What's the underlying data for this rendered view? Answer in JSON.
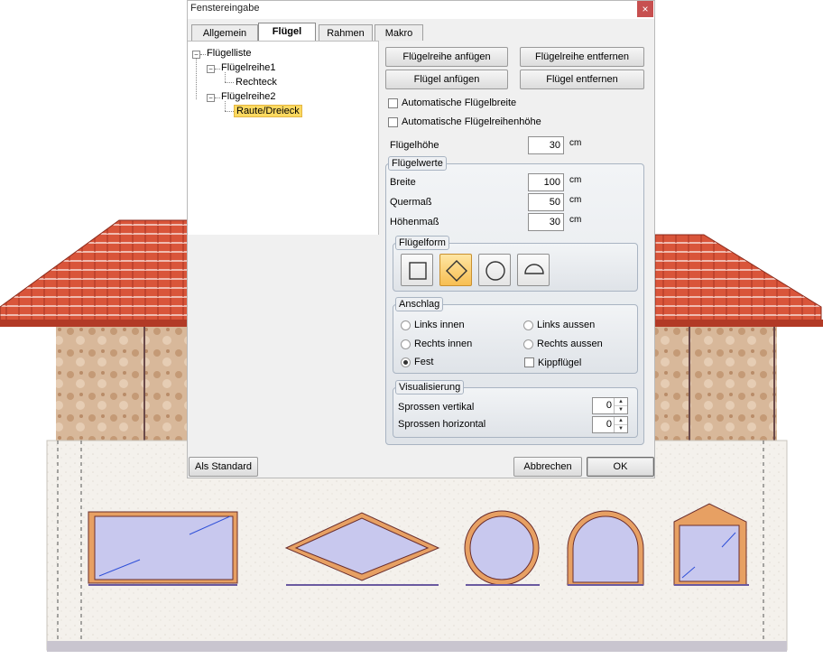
{
  "window": {
    "title": "Fenstereingabe",
    "close_glyph": "×"
  },
  "tabs": [
    {
      "label": "Allgemein"
    },
    {
      "label": "Flügel"
    },
    {
      "label": "Rahmen"
    },
    {
      "label": "Makro"
    }
  ],
  "active_tab": "Flügel",
  "tree": {
    "root": "Flügelliste",
    "rows": [
      {
        "label": "Flügelreihe1",
        "child": "Rechteck"
      },
      {
        "label": "Flügelreihe2",
        "child": "Raute/Dreieck"
      }
    ],
    "selected": "Raute/Dreieck"
  },
  "buttons": {
    "add_row": "Flügelreihe anfügen",
    "remove_row": "Flügelreihe entfernen",
    "add_sash": "Flügel anfügen",
    "remove_sash": "Flügel entfernen",
    "default": "Als Standard",
    "cancel": "Abbrechen",
    "ok": "OK"
  },
  "options": {
    "auto_width": "Automatische Flügelbreite",
    "auto_row_height": "Automatische Flügelreihenhöhe"
  },
  "sash_height": {
    "label": "Flügelhöhe",
    "value": "30",
    "unit": "cm"
  },
  "sash_values": {
    "title": "Flügelwerte",
    "fields": [
      {
        "label": "Breite",
        "value": "100",
        "unit": "cm"
      },
      {
        "label": "Quermaß",
        "value": "50",
        "unit": "cm"
      },
      {
        "label": "Höhenmaß",
        "value": "30",
        "unit": "cm"
      }
    ]
  },
  "sash_shape": {
    "title": "Flügelform",
    "shapes": [
      "square-icon",
      "diamond-icon",
      "circle-icon",
      "semicircle-icon"
    ],
    "selected": "diamond-icon"
  },
  "hinge": {
    "title": "Anschlag",
    "options": [
      "Links innen",
      "Links aussen",
      "Rechts innen",
      "Rechts aussen",
      "Fest"
    ],
    "selected": "Fest",
    "tilt_label": "Kippflügel"
  },
  "visualization": {
    "title": "Visualisierung",
    "vertical_label": "Sprossen vertikal",
    "vertical_value": "0",
    "horizontal_label": "Sprossen horizontal",
    "horizontal_value": "0"
  },
  "colors": {
    "selected_highlight": "#fbd960",
    "roof_tile": "#d9553a",
    "glass": "#c8c8ee",
    "frame": "#e7a063"
  }
}
